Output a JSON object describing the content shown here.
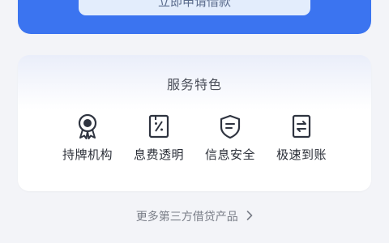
{
  "banner": {
    "button_label": "立即申请借款"
  },
  "features_card": {
    "title": "服务特色",
    "items": [
      {
        "label": "持牌机构",
        "icon": "certified-medal-icon"
      },
      {
        "label": "息费透明",
        "icon": "percent-doc-icon"
      },
      {
        "label": "信息安全",
        "icon": "shield-icon"
      },
      {
        "label": "极速到账",
        "icon": "transfer-doc-icon"
      }
    ]
  },
  "footer": {
    "more_link": "更多第三方借贷产品"
  },
  "colors": {
    "brand_blue": "#3b74f0",
    "icon_dark": "#2f3440",
    "text_dark": "#2b2f38"
  }
}
